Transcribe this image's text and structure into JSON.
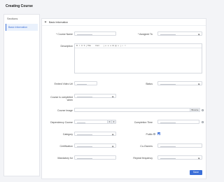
{
  "page": {
    "title": "Creating Course"
  },
  "sidebar": {
    "heading": "Sections",
    "items": [
      {
        "label": "Basic Information"
      }
    ]
  },
  "panel": {
    "header": "Basic Information"
  },
  "form": {
    "course_name_label": "* Course Name",
    "assigned_to_label": "* Assigned To",
    "description_label": "Description",
    "embed_video_label": "Embed Video Url",
    "status_label": "Status",
    "completed_when_label": "Course is completed when",
    "course_image_label": "Course Image",
    "browse_label": "Browse",
    "dependency_label": "Dependency Course",
    "completion_time_label": "Completion Time",
    "category_label": "Category",
    "public_label": "Public",
    "certification_label": "Certification",
    "co_owners_label": "Co-Owners",
    "mandatory_label": "Mandatory for",
    "repeat_label": "Repeat frequency",
    "public_checked": true
  },
  "editor": {
    "toolbar": [
      "B",
      "I",
      "U",
      "S",
      "Title",
      "Font",
      "≡",
      "≡",
      "≡",
      "⊞",
      "▤",
      "∞",
      "☺",
      "⛶"
    ]
  },
  "actions": {
    "save_label": "Save"
  },
  "colors": {
    "accent": "#3b6fd8"
  }
}
